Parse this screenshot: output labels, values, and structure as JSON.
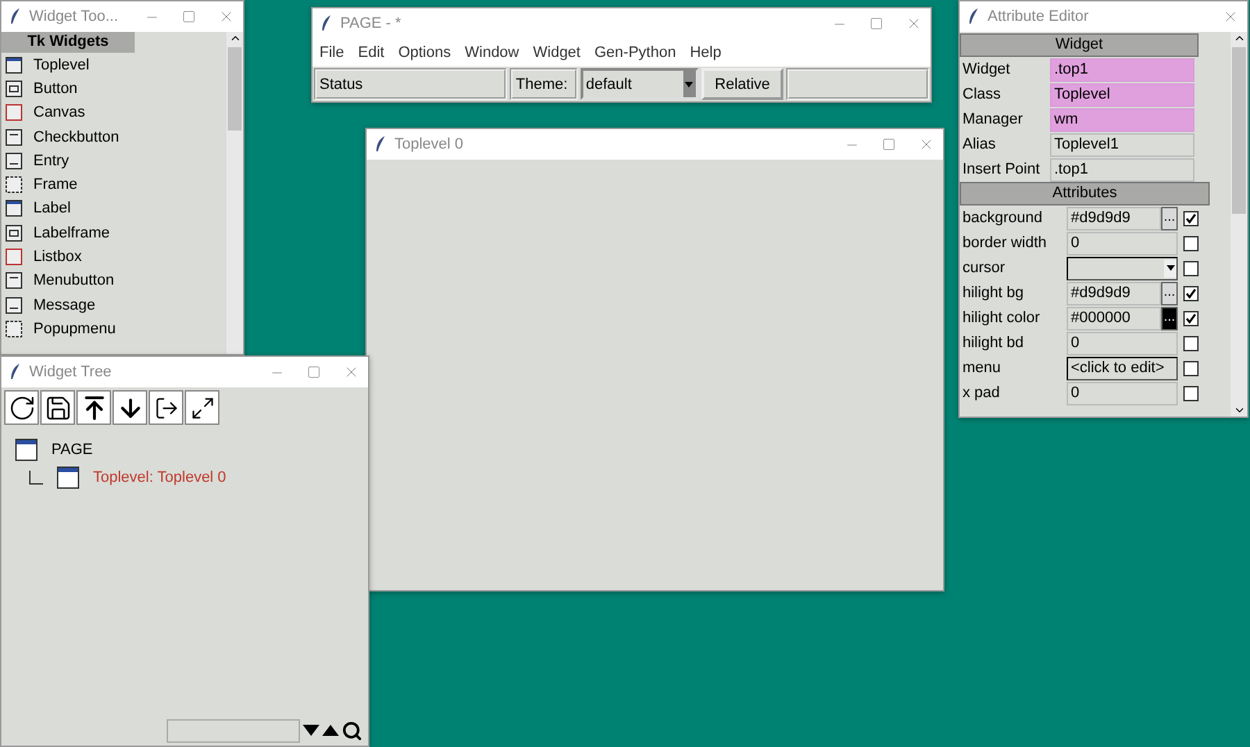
{
  "widget_toolbar": {
    "title": "Widget Too...",
    "section": "Tk Widgets",
    "items": [
      {
        "label": "Toplevel"
      },
      {
        "label": "Button"
      },
      {
        "label": "Canvas"
      },
      {
        "label": "Checkbutton"
      },
      {
        "label": "Entry"
      },
      {
        "label": "Frame"
      },
      {
        "label": "Label"
      },
      {
        "label": "Labelframe"
      },
      {
        "label": "Listbox"
      },
      {
        "label": "Menubutton"
      },
      {
        "label": "Message"
      },
      {
        "label": "Popupmenu"
      }
    ]
  },
  "main_window": {
    "title": "PAGE - *",
    "menu": [
      "File",
      "Edit",
      "Options",
      "Window",
      "Widget",
      "Gen-Python",
      "Help"
    ],
    "status": "Status",
    "theme_label": "Theme:",
    "theme": "default",
    "relative_button": "Relative"
  },
  "toplevel": {
    "title": "Toplevel 0"
  },
  "attribute_editor": {
    "title": "Attribute Editor",
    "widget_header": "Widget",
    "widget_rows": [
      {
        "label": "Widget",
        "value": ".top1",
        "highlighted": true
      },
      {
        "label": "Class",
        "value": "Toplevel",
        "highlighted": true
      },
      {
        "label": "Manager",
        "value": "wm",
        "highlighted": true
      },
      {
        "label": "Alias",
        "value": "Toplevel1",
        "highlighted": false
      },
      {
        "label": "Insert Point",
        "value": ".top1",
        "highlighted": false
      }
    ],
    "attributes_header": "Attributes",
    "attributes": [
      {
        "label": "background",
        "kind": "color",
        "value": "#d9d9d9",
        "button": "...",
        "checked": true
      },
      {
        "label": "border width",
        "kind": "text",
        "value": "0",
        "checked": false
      },
      {
        "label": "cursor",
        "kind": "dropdown",
        "checked": false
      },
      {
        "label": "hilight bg",
        "kind": "color",
        "value": "#d9d9d9",
        "button": "...",
        "checked": true
      },
      {
        "label": "hilight color",
        "kind": "color",
        "value": "#000000",
        "button": "...",
        "checked": true
      },
      {
        "label": "hilight bd",
        "kind": "text",
        "value": "0",
        "checked": false
      },
      {
        "label": "menu",
        "kind": "menu",
        "value": "<click to edit>",
        "checked": false
      },
      {
        "label": "x pad",
        "kind": "text",
        "value": "0",
        "checked": false
      }
    ]
  },
  "widget_tree": {
    "title": "Widget Tree",
    "tree": [
      {
        "label": "PAGE",
        "selected": false,
        "children": [
          {
            "label": "Toplevel: Toplevel 0",
            "selected": true
          }
        ]
      }
    ]
  }
}
